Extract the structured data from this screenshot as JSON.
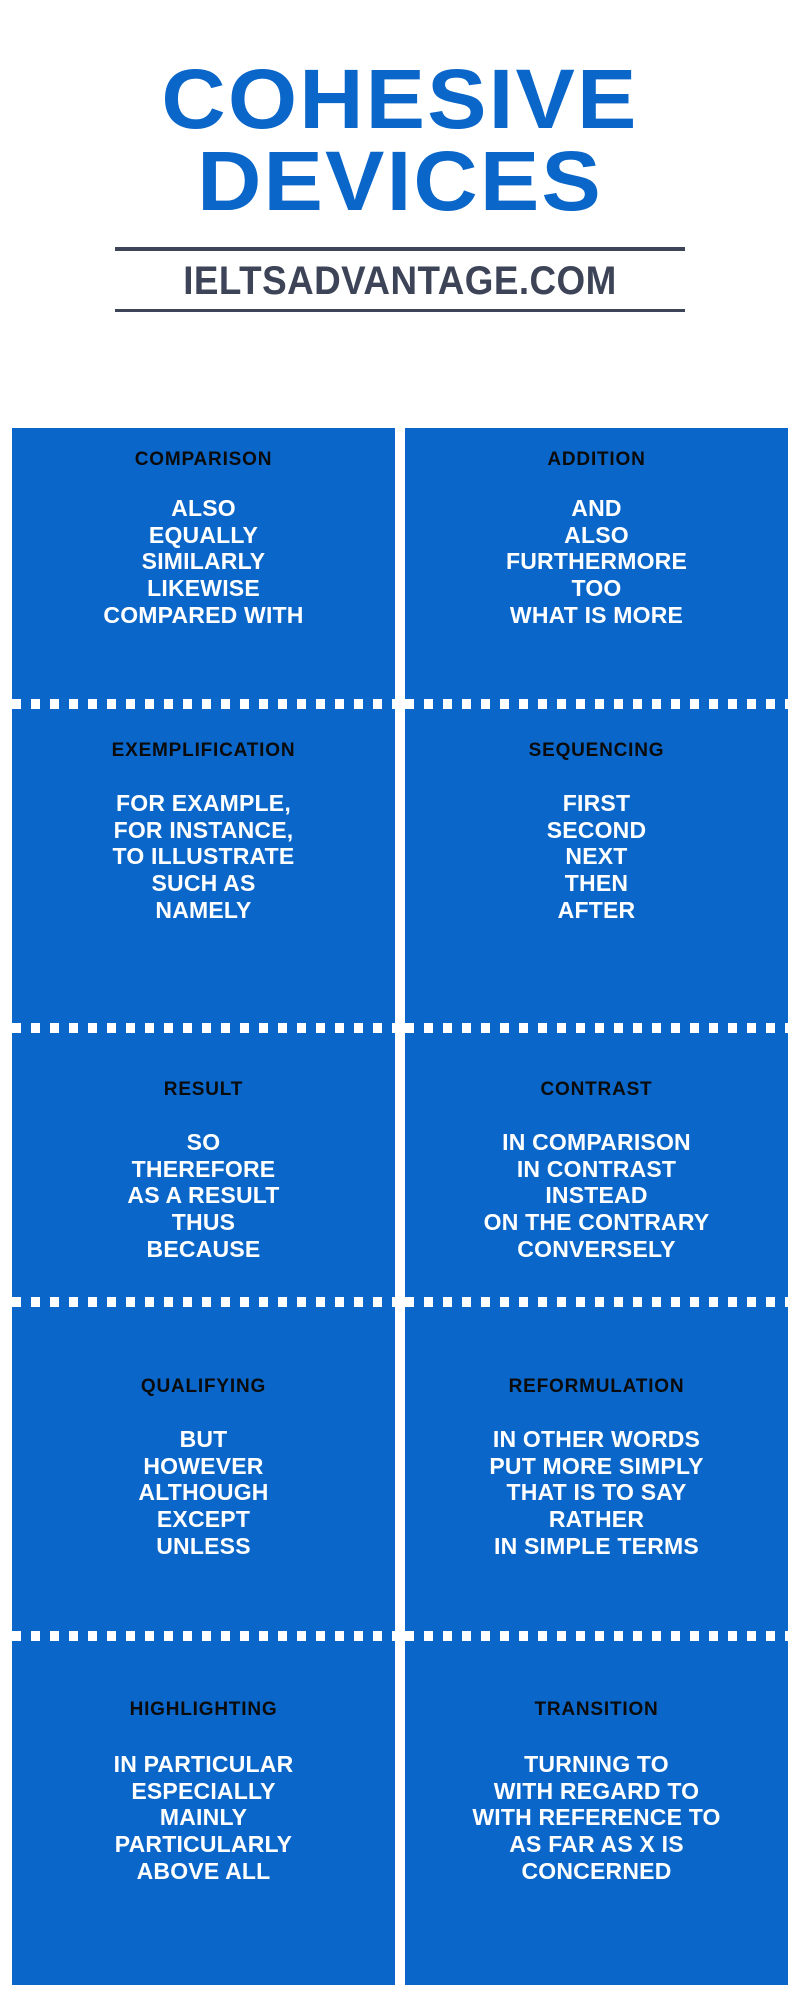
{
  "header": {
    "title_line1": "COHESIVE",
    "title_line2": "DEVICES",
    "subtitle": "IELTSADVANTAGE.COM",
    "title_color": "#0a66c9",
    "subtitle_color": "#3d4457"
  },
  "theme": {
    "panel_color": "#0a66c9",
    "heading_color": "#0b0b0b",
    "item_color": "#ffffff",
    "background": "#ffffff",
    "divider_style": "white-dashed"
  },
  "columns": [
    {
      "name": "left",
      "cells": [
        {
          "heading": "COMPARISON",
          "items": [
            "ALSO",
            "EQUALLY",
            "SIMILARLY",
            "LIKEWISE",
            "COMPARED WITH"
          ]
        },
        {
          "heading": "EXEMPLIFICATION",
          "items": [
            "FOR EXAMPLE,",
            "FOR INSTANCE,",
            "TO ILLUSTRATE",
            "SUCH AS",
            "NAMELY"
          ]
        },
        {
          "heading": "RESULT",
          "items": [
            "SO",
            "THEREFORE",
            "AS A RESULT",
            "THUS",
            "BECAUSE"
          ]
        },
        {
          "heading": "QUALIFYING",
          "items": [
            "BUT",
            "HOWEVER",
            "ALTHOUGH",
            "EXCEPT",
            "UNLESS"
          ]
        },
        {
          "heading": "HIGHLIGHTING",
          "items": [
            "IN PARTICULAR",
            "ESPECIALLY",
            "MAINLY",
            "PARTICULARLY",
            "ABOVE ALL"
          ]
        }
      ]
    },
    {
      "name": "right",
      "cells": [
        {
          "heading": "ADDITION",
          "items": [
            "AND",
            "ALSO",
            "FURTHERMORE",
            "TOO",
            "WHAT IS MORE"
          ]
        },
        {
          "heading": "SEQUENCING",
          "items": [
            "FIRST",
            "SECOND",
            "NEXT",
            "THEN",
            "AFTER"
          ]
        },
        {
          "heading": "CONTRAST",
          "items": [
            "IN COMPARISON",
            "IN CONTRAST",
            "INSTEAD",
            "ON THE CONTRARY",
            "CONVERSELY"
          ]
        },
        {
          "heading": "REFORMULATION",
          "items": [
            "IN OTHER WORDS",
            "PUT MORE SIMPLY",
            "THAT IS TO SAY",
            "RATHER",
            "IN SIMPLE TERMS"
          ]
        },
        {
          "heading": "TRANSITION",
          "items": [
            "TURNING TO",
            "WITH REGARD TO",
            "WITH REFERENCE TO",
            "AS FAR AS X IS",
            "CONCERNED"
          ]
        }
      ]
    }
  ]
}
